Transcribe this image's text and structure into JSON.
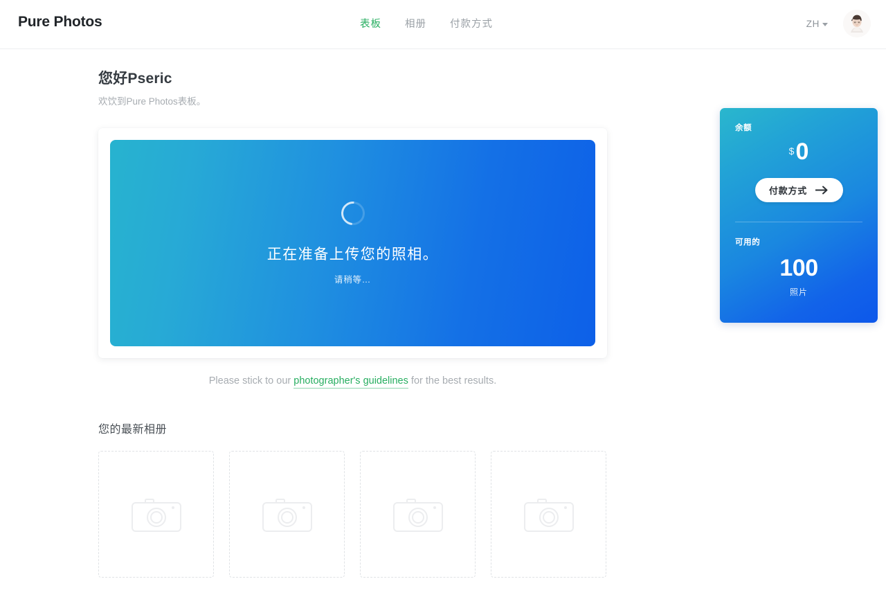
{
  "header": {
    "brand": "Pure Photos",
    "nav": [
      {
        "label": "表板",
        "active": true
      },
      {
        "label": "相册",
        "active": false
      },
      {
        "label": "付款方式",
        "active": false
      }
    ],
    "language": "ZH",
    "avatar_alt": "user-avatar"
  },
  "main": {
    "greeting_title": "您好Pseric",
    "greeting_subtitle": "欢饮到Pure Photos表板。",
    "upload": {
      "title": "正在准备上传您的照相。",
      "subtitle": "请稍等…",
      "gradient_from": "#27b3cf",
      "gradient_to": "#0d60e8"
    },
    "guideline": {
      "prefix": "Please stick to our ",
      "link": "photographer's guidelines",
      "suffix": " for the best results.",
      "link_color": "#27ae60"
    },
    "albums": {
      "title": "您的最新相册",
      "placeholders": [
        {
          "icon": "camera-icon"
        },
        {
          "icon": "camera-icon"
        },
        {
          "icon": "camera-icon"
        },
        {
          "icon": "camera-icon"
        }
      ]
    }
  },
  "sidebar": {
    "balance_label": "余额",
    "currency_symbol": "$",
    "balance_value": "0",
    "pay_button_label": "付款方式",
    "available_label": "可用的",
    "photos_count": "100",
    "photos_unit": "照片",
    "gradient_from": "#2ab7cd",
    "gradient_to": "#0d58eb"
  }
}
